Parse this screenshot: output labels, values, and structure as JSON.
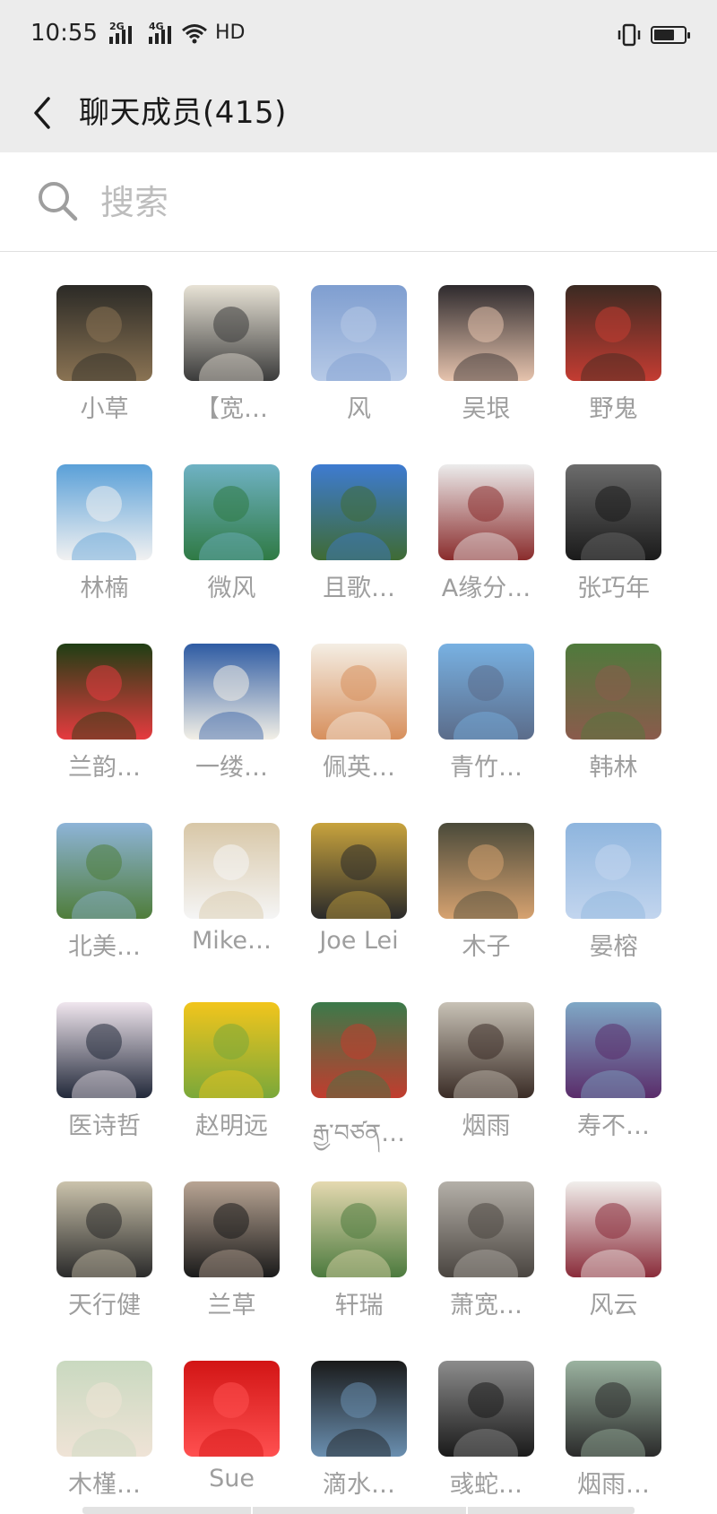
{
  "status_bar": {
    "time": "10:55",
    "network_1": "2G",
    "network_2": "4G",
    "hd": "HD",
    "battery_level": 0.7
  },
  "header": {
    "title": "聊天成员(415)"
  },
  "search": {
    "placeholder": "搜索",
    "value": ""
  },
  "members": [
    {
      "name": "小草",
      "colors": [
        "#2b2a26",
        "#8a7353"
      ]
    },
    {
      "name": "【宽…",
      "colors": [
        "#e8e3d6",
        "#3b3b3b"
      ]
    },
    {
      "name": "风",
      "colors": [
        "#7f9ed0",
        "#b6c9e6"
      ]
    },
    {
      "name": "吴垠",
      "colors": [
        "#2e2a2d",
        "#e6c3ad"
      ]
    },
    {
      "name": "野鬼",
      "colors": [
        "#3a2a22",
        "#c43c32"
      ]
    },
    {
      "name": "林楠",
      "colors": [
        "#5aa0d8",
        "#f1f1f1"
      ]
    },
    {
      "name": "微风",
      "colors": [
        "#6fb2c4",
        "#2f7a44"
      ]
    },
    {
      "name": "且歌…",
      "colors": [
        "#3e7bd1",
        "#3f6b34"
      ]
    },
    {
      "name": "A缘分…",
      "colors": [
        "#ececec",
        "#8a2c2c"
      ]
    },
    {
      "name": "张巧年",
      "colors": [
        "#6c6c6c",
        "#1a1a1a"
      ]
    },
    {
      "name": "兰韵…",
      "colors": [
        "#1f3e14",
        "#e63b3f"
      ]
    },
    {
      "name": "一缕…",
      "colors": [
        "#2e5ba3",
        "#f2efe6"
      ]
    },
    {
      "name": "佩英…",
      "colors": [
        "#f4eee4",
        "#d78f5c"
      ]
    },
    {
      "name": "青竹…",
      "colors": [
        "#78b1e2",
        "#5b6c8a"
      ]
    },
    {
      "name": "韩林",
      "colors": [
        "#4f7a3c",
        "#8a5b4c"
      ]
    },
    {
      "name": "北美…",
      "colors": [
        "#8eb4d8",
        "#4f7d3a"
      ]
    },
    {
      "name": "Mike…",
      "colors": [
        "#d8c7a7",
        "#f5f5f5"
      ]
    },
    {
      "name": "Joe Lei",
      "colors": [
        "#c8a33d",
        "#2a2a2a"
      ]
    },
    {
      "name": "木子",
      "colors": [
        "#4a4a3a",
        "#d6a270"
      ]
    },
    {
      "name": "晏榕",
      "colors": [
        "#8eb5de",
        "#c2d5ee"
      ]
    },
    {
      "name": "医诗哲",
      "colors": [
        "#f0e6ee",
        "#22293a"
      ]
    },
    {
      "name": "赵明远",
      "colors": [
        "#f2c51c",
        "#7aa83a"
      ]
    },
    {
      "name": "རྒྱ་བཙན…",
      "colors": [
        "#3b7a4a",
        "#c23c2e"
      ]
    },
    {
      "name": "烟雨",
      "colors": [
        "#c8c2b6",
        "#3a2c26"
      ]
    },
    {
      "name": "寿不…",
      "colors": [
        "#7fa8c6",
        "#5a2c6a"
      ]
    },
    {
      "name": "天行健",
      "colors": [
        "#cbc3ac",
        "#2a2a2a"
      ]
    },
    {
      "name": "兰草",
      "colors": [
        "#b9a594",
        "#1a1a1a"
      ]
    },
    {
      "name": "轩瑞",
      "colors": [
        "#e5d9b0",
        "#4c7a3e"
      ]
    },
    {
      "name": "萧宽…",
      "colors": [
        "#b4b0a8",
        "#4a4540"
      ]
    },
    {
      "name": "风云",
      "colors": [
        "#f1efec",
        "#8a2c3a"
      ]
    },
    {
      "name": "木槿…",
      "colors": [
        "#c9d9c0",
        "#efe3d6"
      ]
    },
    {
      "name": "Sue",
      "colors": [
        "#d21515",
        "#ff5050"
      ]
    },
    {
      "name": "滴水…",
      "colors": [
        "#1a1a1a",
        "#6a8fb0"
      ]
    },
    {
      "name": "彧蛇…",
      "colors": [
        "#8c8c8c",
        "#1a1a1a"
      ]
    },
    {
      "name": "烟雨…",
      "colors": [
        "#9bb3a0",
        "#2a2a2a"
      ]
    }
  ]
}
